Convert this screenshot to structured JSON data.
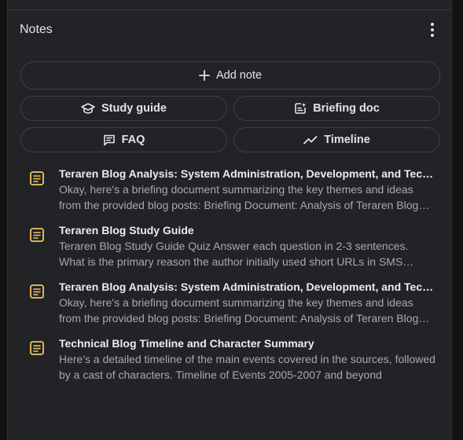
{
  "panel": {
    "title": "Notes",
    "menu_icon": "more-vert-icon"
  },
  "actions": {
    "add_note": {
      "label": "Add note",
      "icon": "plus-icon"
    },
    "study_guide": {
      "label": "Study guide",
      "icon": "graduation-cap-icon"
    },
    "briefing_doc": {
      "label": "Briefing doc",
      "icon": "briefing-doc-icon"
    },
    "faq": {
      "label": "FAQ",
      "icon": "chat-lines-icon"
    },
    "timeline": {
      "label": "Timeline",
      "icon": "trend-line-icon"
    }
  },
  "notes": [
    {
      "title": "Teraren Blog Analysis: System Administration, Development, and Technology",
      "snippet": "Okay, here's a briefing document summarizing the key themes and ideas from the provided blog posts: Briefing Document: Analysis of Teraren Blog Posts",
      "icon": "note-icon"
    },
    {
      "title": "Teraren Blog Study Guide",
      "snippet": "Teraren Blog Study Guide Quiz Answer each question in 2-3 sentences. What is the primary reason the author initially used short URLs in SMS messages?",
      "icon": "note-icon"
    },
    {
      "title": "Teraren Blog Analysis: System Administration, Development, and Technology",
      "snippet": "Okay, here's a briefing document summarizing the key themes and ideas from the provided blog posts: Briefing Document: Analysis of Teraren Blog Posts",
      "icon": "note-icon"
    },
    {
      "title": "Technical Blog Timeline and Character Summary",
      "snippet": "Here's a detailed timeline of the main events covered in the sources, followed by a cast of characters. Timeline of Events 2005-2007 and beyond",
      "icon": "note-icon"
    }
  ],
  "colors": {
    "background": "#131314",
    "panel": "#222327",
    "border": "#3f4044",
    "note_icon": "#f0c75e",
    "text": "#e3e3e3",
    "muted_text": "#a8a9ad"
  }
}
